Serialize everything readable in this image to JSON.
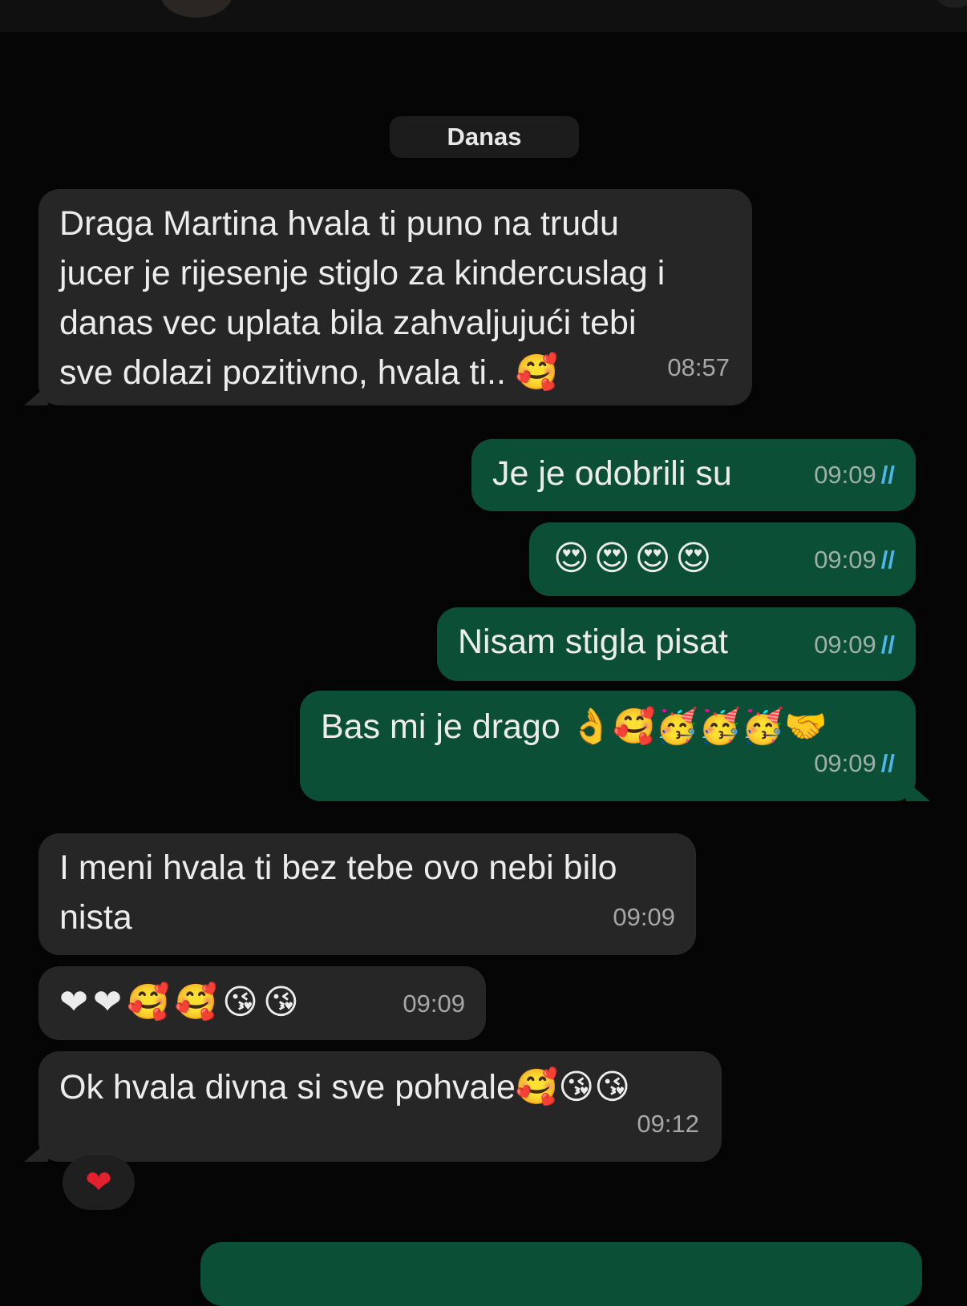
{
  "header": {
    "avatar": "contact-avatar",
    "right_icon": "call-icon"
  },
  "date_separator": "Danas",
  "messages": [
    {
      "direction": "in",
      "text": "Draga Martina hvala ti puno na trudu\njucer je rijesenje stiglo za kindercuslag i\ndanas vec uplata bila zahvaljujući tebi\nsve dolazi pozitivno, hvala ti.. 🥰",
      "time": "08:57"
    },
    {
      "direction": "out",
      "text": "Je je odobrili su",
      "time": "09:09",
      "status": "read"
    },
    {
      "direction": "out",
      "text": "😍😍😍😍",
      "time": "09:09",
      "status": "read"
    },
    {
      "direction": "out",
      "text": "Nisam stigla pisat",
      "time": "09:09",
      "status": "read"
    },
    {
      "direction": "out",
      "text": "Bas mi je drago 👌🥰🥳🥳🥳🤝",
      "time": "09:09",
      "status": "read"
    },
    {
      "direction": "in",
      "text": "I meni hvala ti bez tebe ovo nebi bilo\nnista",
      "time": "09:09"
    },
    {
      "direction": "in",
      "text": "❤❤🥰🥰😘😘",
      "time": "09:09"
    },
    {
      "direction": "in",
      "text": "Ok hvala divna si sve pohvale🥰😘😘",
      "time": "09:12",
      "reaction": "❤"
    }
  ],
  "read_ticks": "//",
  "colors": {
    "incoming": "#262626",
    "outgoing": "#0b4f37",
    "ticks": "#4fb6ec",
    "background": "#050505"
  }
}
